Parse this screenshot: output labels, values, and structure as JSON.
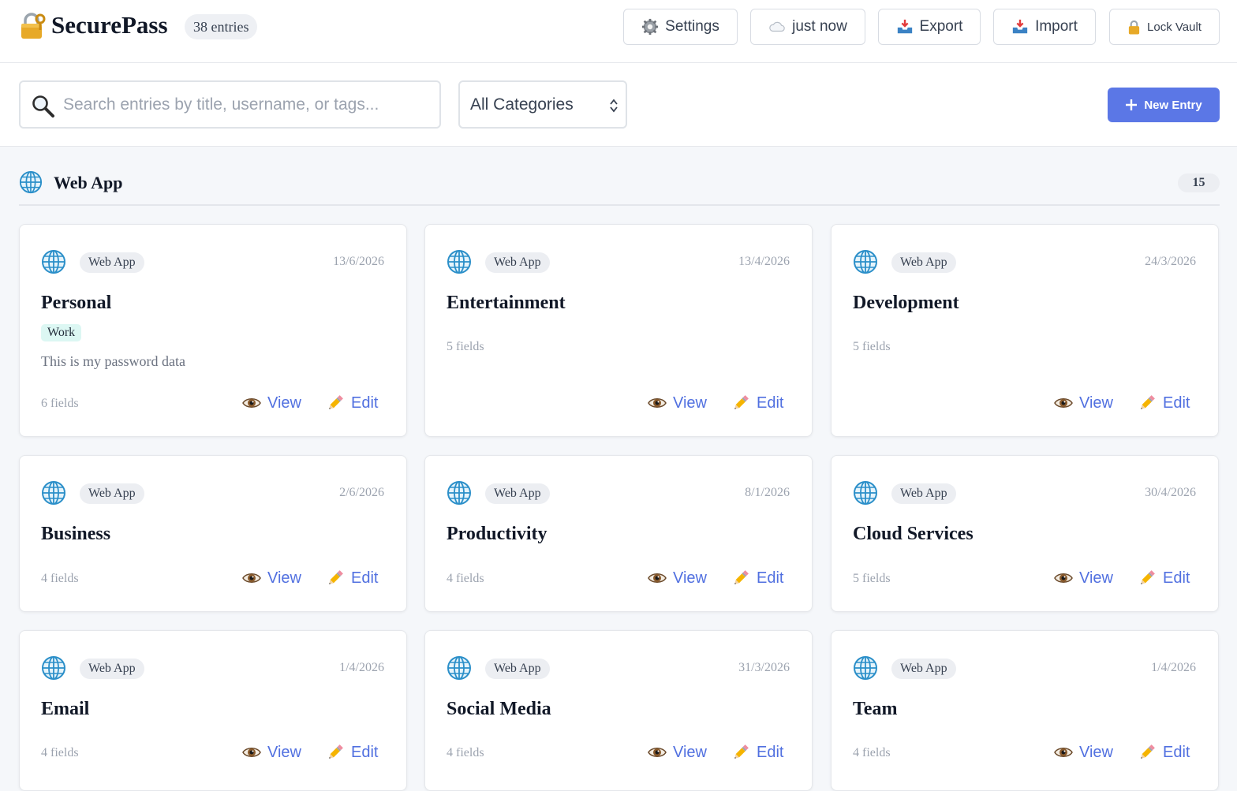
{
  "header": {
    "app_name": "SecurePass",
    "entry_count": "38 entries",
    "buttons": {
      "settings": "Settings",
      "sync": "just now",
      "export": "Export",
      "import": "Import",
      "lock": "Lock Vault"
    }
  },
  "toolbar": {
    "search_placeholder": "Search entries by title, username, or tags...",
    "search_value": "",
    "category_selected": "All Categories",
    "new_entry_label": "New Entry"
  },
  "section": {
    "title": "Web App",
    "count": "15",
    "icon": "globe-icon"
  },
  "actions": {
    "view": "View",
    "edit": "Edit"
  },
  "cards": [
    {
      "type": "Web App",
      "date": "13/6/2026",
      "title": "Personal",
      "tag": "Work",
      "note": "This is my password data",
      "fields": "6 fields"
    },
    {
      "type": "Web App",
      "date": "13/4/2026",
      "title": "Entertainment",
      "fields": "5 fields"
    },
    {
      "type": "Web App",
      "date": "24/3/2026",
      "title": "Development",
      "fields": "5 fields"
    },
    {
      "type": "Web App",
      "date": "2/6/2026",
      "title": "Business",
      "fields": "4 fields"
    },
    {
      "type": "Web App",
      "date": "8/1/2026",
      "title": "Productivity",
      "fields": "4 fields"
    },
    {
      "type": "Web App",
      "date": "30/4/2026",
      "title": "Cloud Services",
      "fields": "5 fields"
    },
    {
      "type": "Web App",
      "date": "1/4/2026",
      "title": "Email",
      "fields": "4 fields"
    },
    {
      "type": "Web App",
      "date": "31/3/2026",
      "title": "Social Media",
      "fields": "4 fields"
    },
    {
      "type": "Web App",
      "date": "1/4/2026",
      "title": "Team",
      "fields": "4 fields"
    }
  ],
  "colors": {
    "accent": "#5b77e6",
    "link": "#5170e0",
    "tag_bg": "#dcf7f3",
    "page_bg": "#f5f7fa"
  }
}
